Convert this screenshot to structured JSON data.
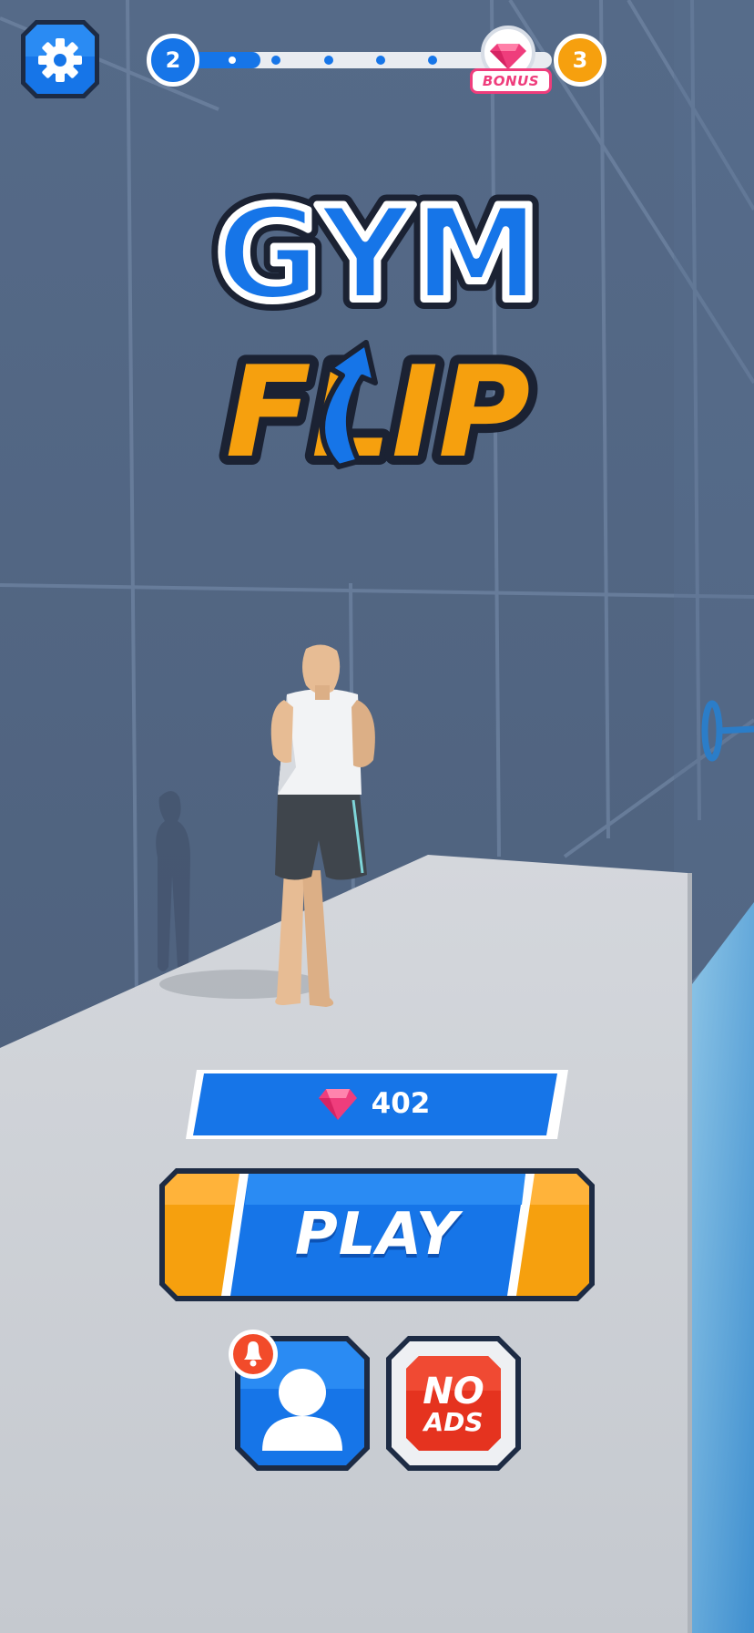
{
  "hud": {
    "settings_icon": "gear-icon",
    "level_current": "2",
    "level_next": "3",
    "level_progress_fraction": 0.2,
    "bonus_label": "BONUS",
    "bonus_icon": "diamond-icon"
  },
  "logo": {
    "word1": "GYM",
    "word2": "FLIP"
  },
  "currency": {
    "icon": "diamond-icon",
    "amount": "402"
  },
  "actions": {
    "play_label": "PLAY",
    "profile_icon": "user-icon",
    "notification_icon": "bell-icon",
    "no_ads_line1": "NO",
    "no_ads_line2": "ADS"
  },
  "colors": {
    "primary_blue": "#1675e8",
    "accent_orange": "#f6a00e",
    "gem_pink": "#ef3d7c",
    "no_ads_red": "#e5331f",
    "background": "#50637f"
  }
}
